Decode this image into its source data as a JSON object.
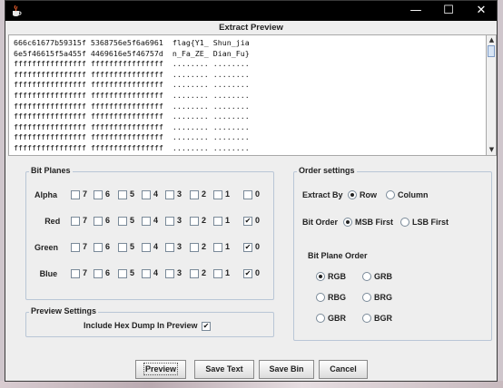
{
  "window": {
    "controls": {
      "minimize": "—",
      "maximize": "☐",
      "close": "✕"
    },
    "title_icon": "java-cup-icon"
  },
  "preview": {
    "title": "Extract Preview",
    "lines": [
      "666c61677b59315f 5368756e5f6a6961  flag{Y1_ Shun_jia",
      "6e5f46615f5a455f 4469616e5f46757d  n_Fa_ZE_ Dian_Fu}",
      "ffffffffffffffff ffffffffffffffff  ........ ........",
      "ffffffffffffffff ffffffffffffffff  ........ ........",
      "ffffffffffffffff ffffffffffffffff  ........ ........",
      "ffffffffffffffff ffffffffffffffff  ........ ........",
      "ffffffffffffffff ffffffffffffffff  ........ ........",
      "ffffffffffffffff ffffffffffffffff  ........ ........",
      "ffffffffffffffff ffffffffffffffff  ........ ........",
      "ffffffffffffffff ffffffffffffffff  ........ ........",
      "ffffffffffffffff ffffffffffffffff  ........ ........"
    ]
  },
  "bit_planes": {
    "title": "Bit Planes",
    "bit_labels": [
      "7",
      "6",
      "5",
      "4",
      "3",
      "2",
      "1",
      "0"
    ],
    "rows": [
      {
        "label": "Alpha",
        "checked": [
          false,
          false,
          false,
          false,
          false,
          false,
          false,
          false
        ]
      },
      {
        "label": "Red",
        "checked": [
          false,
          false,
          false,
          false,
          false,
          false,
          false,
          true
        ]
      },
      {
        "label": "Green",
        "checked": [
          false,
          false,
          false,
          false,
          false,
          false,
          false,
          true
        ]
      },
      {
        "label": "Blue",
        "checked": [
          false,
          false,
          false,
          false,
          false,
          false,
          false,
          true
        ]
      }
    ]
  },
  "preview_settings": {
    "title": "Preview Settings",
    "hex_dump_label": "Include Hex Dump In Preview",
    "hex_dump_checked": true
  },
  "order_settings": {
    "title": "Order settings",
    "extract_by": {
      "label": "Extract By",
      "options": [
        "Row",
        "Column"
      ],
      "selected": "Row"
    },
    "bit_order": {
      "label": "Bit Order",
      "options": [
        "MSB First",
        "LSB First"
      ],
      "selected": "MSB First"
    },
    "plane_order": {
      "label": "Bit Plane Order",
      "options": [
        "RGB",
        "GRB",
        "RBG",
        "BRG",
        "GBR",
        "BGR"
      ],
      "selected": "RGB"
    }
  },
  "buttons": {
    "preview": "Preview",
    "save_text": "Save Text",
    "save_bin": "Save Bin",
    "cancel": "Cancel"
  },
  "check_mark": "✔"
}
